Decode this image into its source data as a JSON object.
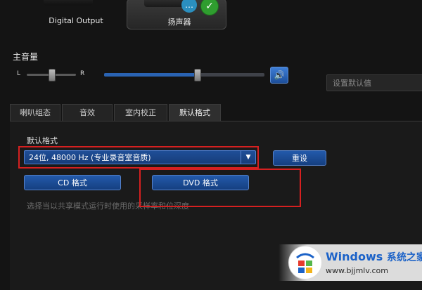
{
  "devices": {
    "digital_output_label": "Digital Output",
    "speaker_label": "扬声器"
  },
  "master_volume": {
    "title": "主音量",
    "left_label": "L",
    "right_label": "R",
    "balance_level": 0.5,
    "volume_level": 0.58,
    "mute_icon": "speaker-icon"
  },
  "set_default": {
    "placeholder": "设置默认值"
  },
  "tabs": [
    {
      "label": "喇叭组态"
    },
    {
      "label": "音效"
    },
    {
      "label": "室内校正"
    },
    {
      "label": "默认格式",
      "active": true
    }
  ],
  "default_format": {
    "field_label": "默认格式",
    "selected_value": "24位, 48000 Hz (专业录音室音质)",
    "reset_label": "重设",
    "cd_label": "CD 格式",
    "dvd_label": "DVD 格式",
    "hint_text": "选择当以共享模式运行时使用的采样率和位深度"
  },
  "watermark": {
    "title": "Windows",
    "title_cn": "系统之家",
    "url": "www.bjjmlv.com"
  },
  "colors": {
    "accent": "#1f4f98",
    "highlight_box": "#d62020",
    "ok_badge": "#2f9d2f"
  }
}
